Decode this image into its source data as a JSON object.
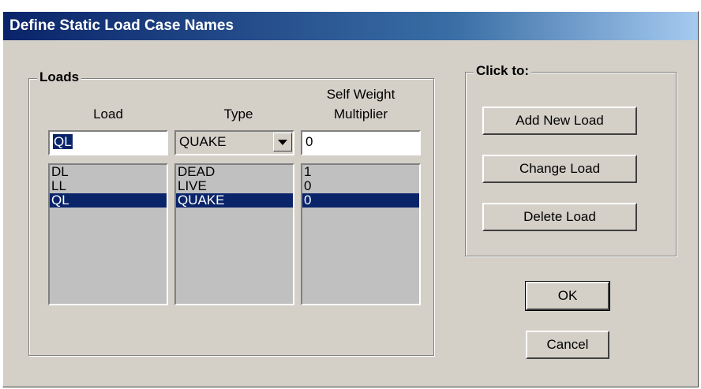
{
  "window": {
    "title": "Define Static Load Case Names"
  },
  "loads_group": {
    "label": "Loads",
    "headers": {
      "load": "Load",
      "type": "Type",
      "multiplier_line1": "Self Weight",
      "multiplier_line2": "Multiplier"
    },
    "inputs": {
      "load_value": "QL",
      "type_value": "QUAKE",
      "multiplier_value": "0"
    },
    "rows": [
      {
        "load": "DL",
        "type": "DEAD",
        "multiplier": "1"
      },
      {
        "load": "LL",
        "type": "LIVE",
        "multiplier": "0"
      },
      {
        "load": "QL",
        "type": "QUAKE",
        "multiplier": "0"
      }
    ],
    "selected_row_index": 2
  },
  "click_group": {
    "label": "Click to:",
    "add_button": "Add New Load",
    "change_button": "Change Load",
    "delete_button": "Delete Load"
  },
  "dialog_buttons": {
    "ok": "OK",
    "cancel": "Cancel"
  },
  "colors": {
    "title_start": "#0a246a",
    "title_end": "#a6caf0",
    "face": "#d4d0c8",
    "selection": "#0a246a",
    "list_bg": "#c0c0c0"
  },
  "icons": {
    "dropdown": "chevron-down-icon"
  }
}
